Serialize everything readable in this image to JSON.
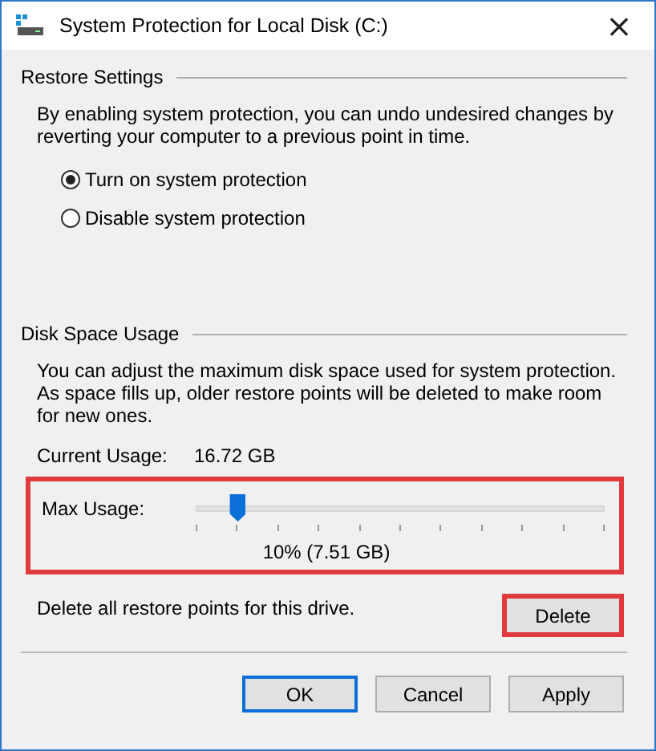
{
  "window": {
    "title": "System Protection for Local Disk (C:)",
    "close": "×"
  },
  "restore_settings": {
    "heading": "Restore Settings",
    "description": "By enabling system protection, you can undo undesired changes by reverting your computer to a previous point in time.",
    "options": [
      {
        "label": "Turn on system protection",
        "selected": true
      },
      {
        "label": "Disable system protection",
        "selected": false
      }
    ]
  },
  "disk_space_usage": {
    "heading": "Disk Space Usage",
    "description": "You can adjust the maximum disk space used for system protection. As space fills up, older restore points will be deleted to make room for new ones.",
    "current_usage": {
      "label": "Current Usage:",
      "value": "16.72 GB"
    },
    "max_usage": {
      "label": "Max Usage:",
      "level": 0.1,
      "reading": "10% (7.51 GB)",
      "highlighted": true
    },
    "delete": {
      "text": "Delete all restore points for this drive.",
      "button": "Delete",
      "highlighted": true
    }
  },
  "buttons": [
    {
      "label": "OK",
      "default": true
    },
    {
      "label": "Cancel",
      "default": false
    },
    {
      "label": "Apply",
      "default": false
    }
  ]
}
